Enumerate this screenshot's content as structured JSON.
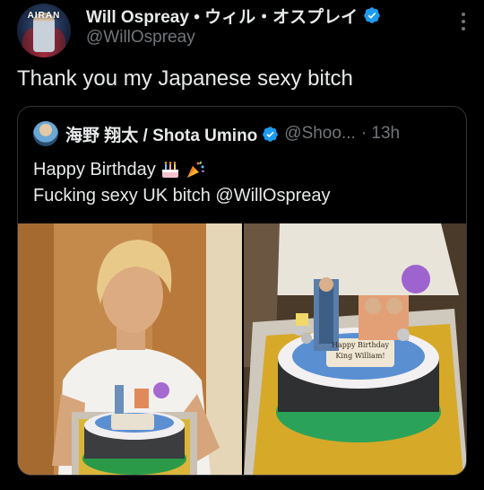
{
  "author": {
    "display_name": "Will Ospreay • ウィル・オスプレイ",
    "handle": "@WillOspreay",
    "avatar_text": "AIRAN"
  },
  "tweet": {
    "text": "Thank you my Japanese sexy bitch"
  },
  "quoted": {
    "display_name": "海野 翔太 / Shota Umino",
    "handle": "@Shoo...",
    "time": "· 13h",
    "line1": "Happy Birthday",
    "line2": "Fucking sexy UK bitch @WillOspreay",
    "cake_plaque_1": "Happy Birthday",
    "cake_plaque_2": "King William!"
  },
  "icons": {
    "verified": "verified-badge-icon",
    "more": "more-options-icon",
    "cake_emoji": "birthday-cake-icon",
    "popper_emoji": "party-popper-icon"
  },
  "colors": {
    "background": "#000000",
    "text": "#e7e9ea",
    "muted": "#71767b",
    "verified": "#1d9bf0",
    "border": "#2f3336"
  }
}
